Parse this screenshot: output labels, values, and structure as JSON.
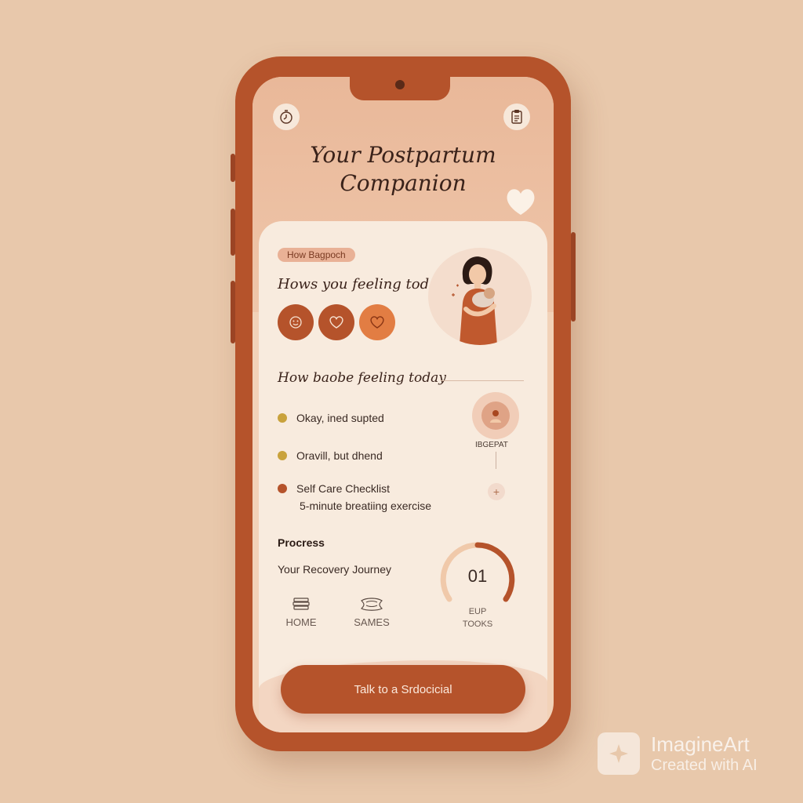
{
  "app": {
    "title_line1": "Your Postpartum",
    "title_line2": "Companion"
  },
  "card": {
    "tag": "How Bagpoch",
    "question": "Hows you feeling today?",
    "mood_icons": [
      "face-icon",
      "heart-icon",
      "heart-icon"
    ],
    "section_title": "How baobe feeling today",
    "items": [
      {
        "text": "Okay, ined supted",
        "color": "#c9a23c"
      },
      {
        "text": "Oravill, but dhend",
        "color": "#c9a23c"
      },
      {
        "text": "Self Care Checklist",
        "color": "#b5532b"
      }
    ],
    "item_sub": "5-minute breatiing exercise",
    "side_label": "IBGEPAT",
    "plus": "+"
  },
  "progress": {
    "heading": "Procress",
    "journey": "Your Recovery Journey",
    "gauge_value": "01",
    "gauge_label_line1": "EUP",
    "gauge_label_line2": "TOOKS"
  },
  "nav": [
    {
      "label": "HOME",
      "icon": "books-icon"
    },
    {
      "label": "SAMES",
      "icon": "scarf-icon"
    }
  ],
  "cta": {
    "label": "Talk to a Srdocicial"
  },
  "watermark": {
    "brand": "ImagineArt",
    "sub": "Created with AI"
  },
  "colors": {
    "background": "#e8c8ab",
    "phone": "#b5532b",
    "accent": "#b5532b",
    "accent_light": "#e27d43"
  }
}
